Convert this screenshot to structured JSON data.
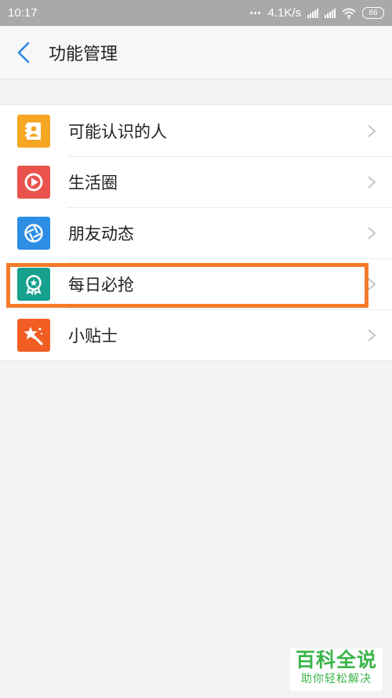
{
  "status_bar": {
    "time": "10:17",
    "dots": "•••",
    "network_speed": "4.1K/s",
    "battery": "66",
    "icons": [
      "signal-icon",
      "signal-icon",
      "wifi-icon",
      "battery-icon"
    ]
  },
  "header": {
    "back_icon": "chevron-left-icon",
    "title": "功能管理"
  },
  "items": [
    {
      "label": "可能认识的人",
      "icon": "contact-book-icon",
      "icon_color": "#f5a623"
    },
    {
      "label": "生活圈",
      "icon": "play-circle-icon",
      "icon_color": "#e9534b"
    },
    {
      "label": "朋友动态",
      "icon": "aperture-icon",
      "icon_color": "#2d8ee6"
    },
    {
      "label": "每日必抢",
      "icon": "award-badge-icon",
      "icon_color": "#16a08d"
    },
    {
      "label": "小贴士",
      "icon": "magic-star-icon",
      "icon_color": "#f15d22"
    }
  ],
  "highlight_color": "#f47b2a",
  "watermark": {
    "title": "百科全说",
    "subtitle": "助你轻松解决"
  }
}
